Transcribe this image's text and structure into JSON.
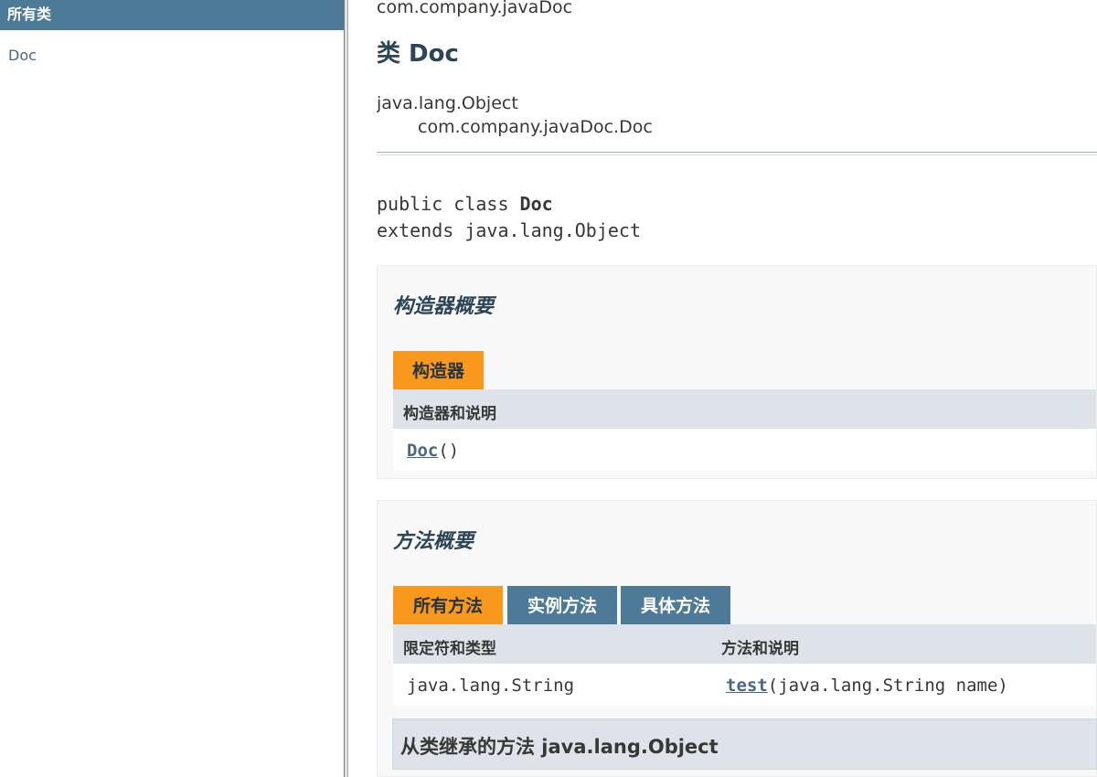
{
  "sidebar": {
    "header": "所有类",
    "classes": [
      "Doc"
    ]
  },
  "main": {
    "package": "com.company.javaDoc",
    "title": "类 Doc",
    "inheritance": [
      "java.lang.Object",
      "com.company.javaDoc.Doc"
    ],
    "signature": {
      "line1_prefix": "public class ",
      "line1_name": "Doc",
      "line2": "extends java.lang.Object"
    },
    "constructor_summary": {
      "heading": "构造器概要",
      "tab": "构造器",
      "column": "构造器和说明",
      "rows": [
        {
          "name": "Doc",
          "params": "()"
        }
      ]
    },
    "method_summary": {
      "heading": "方法概要",
      "tabs": [
        "所有方法",
        "实例方法",
        "具体方法"
      ],
      "columns": [
        "限定符和类型",
        "方法和说明"
      ],
      "rows": [
        {
          "type": "java.lang.String",
          "name": "test",
          "params": "(java.lang.String name)"
        }
      ]
    },
    "inherited_heading": "从类继承的方法 java.lang.Object"
  },
  "colors": {
    "header_blue": "#4d7a97",
    "tab_orange": "#f8981d",
    "table_header": "#dee3e9",
    "link": "#4a6782"
  }
}
